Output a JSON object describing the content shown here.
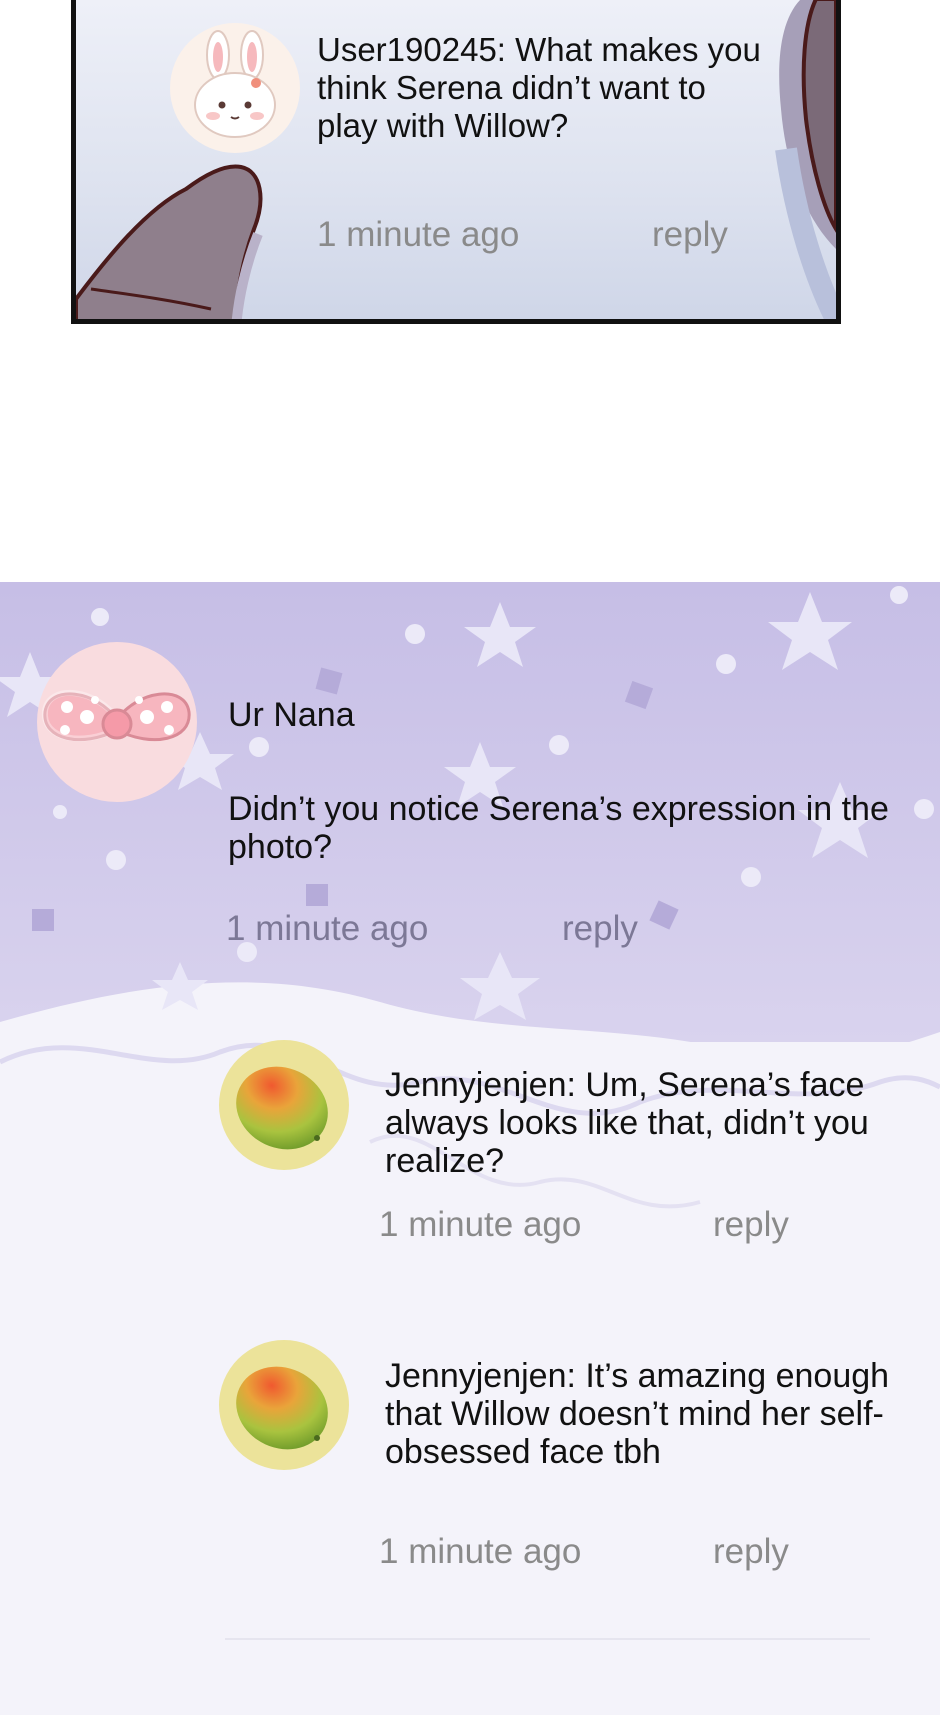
{
  "top_comment": {
    "text": "User190245: What makes you think Serena didn’t want to play with Willow?",
    "time": "1 minute ago",
    "reply": "reply",
    "avatar_icon": "bunny-avatar-icon"
  },
  "main_comment": {
    "username": "Ur Nana",
    "text": "Didn’t you notice Serena’s expression in the photo?",
    "time": "1 minute ago",
    "reply": "reply",
    "avatar_icon": "bow-avatar-icon"
  },
  "replies": [
    {
      "text": "Jennyjenjen: Um, Serena’s face always looks like that, didn’t you realize?",
      "time": "1 minute ago",
      "reply": "reply",
      "avatar_icon": "mango-avatar-icon"
    },
    {
      "text": "Jennyjenjen: It’s amazing enough that Willow doesn’t mind her self-obsessed face tbh",
      "time": "1 minute ago",
      "reply": "reply",
      "avatar_icon": "mango-avatar-icon"
    }
  ],
  "colors": {
    "panel_bg": "#dde2ef",
    "section_purple": "#c9c2e6",
    "meta_text": "#8a8a8a",
    "bow_pink": "#f7b8c0",
    "mango_ring": "#ece39a"
  }
}
